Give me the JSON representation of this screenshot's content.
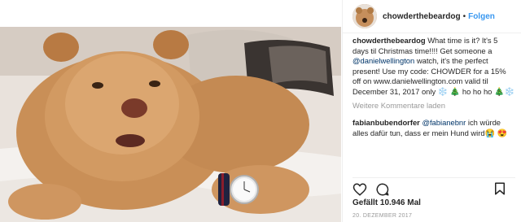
{
  "header": {
    "username": "chowderthebeardog",
    "separator": "•",
    "follow_label": "Folgen"
  },
  "caption": {
    "username": "chowderthebeardog",
    "text_1": "What time is it? It's 5 days til Christmas time!!!! Get someone a ",
    "mention": "@danielwellington",
    "text_2": " watch, it's the perfect present! Use my code: CHOWDER for a 15% off on www.danielwellington.com valid til December 31, 2017 only ",
    "emoji_snowflake_1": "❄️",
    "emoji_tree_1": "🎄",
    "text_3": " ho ho ho ",
    "emoji_tree_2": "🎄",
    "emoji_snowflake_2": "❄️"
  },
  "load_more_label": "Weitere Kommentare laden",
  "comment": {
    "username": "fabianbubendorfer",
    "mention": "@fabianebnr",
    "text": " ich würde alles dafür tun, dass er mein Hund wird",
    "emoji_1": "😭",
    "emoji_2": "😍"
  },
  "likes_text": "Gefällt 10.946 Mal",
  "date_text": "20. DEZEMBER 2017",
  "icons": [
    "heart-icon",
    "comment-icon",
    "bookmark-icon"
  ],
  "colors": {
    "link": "#3897f0",
    "mention": "#003569",
    "muted": "#999999"
  }
}
